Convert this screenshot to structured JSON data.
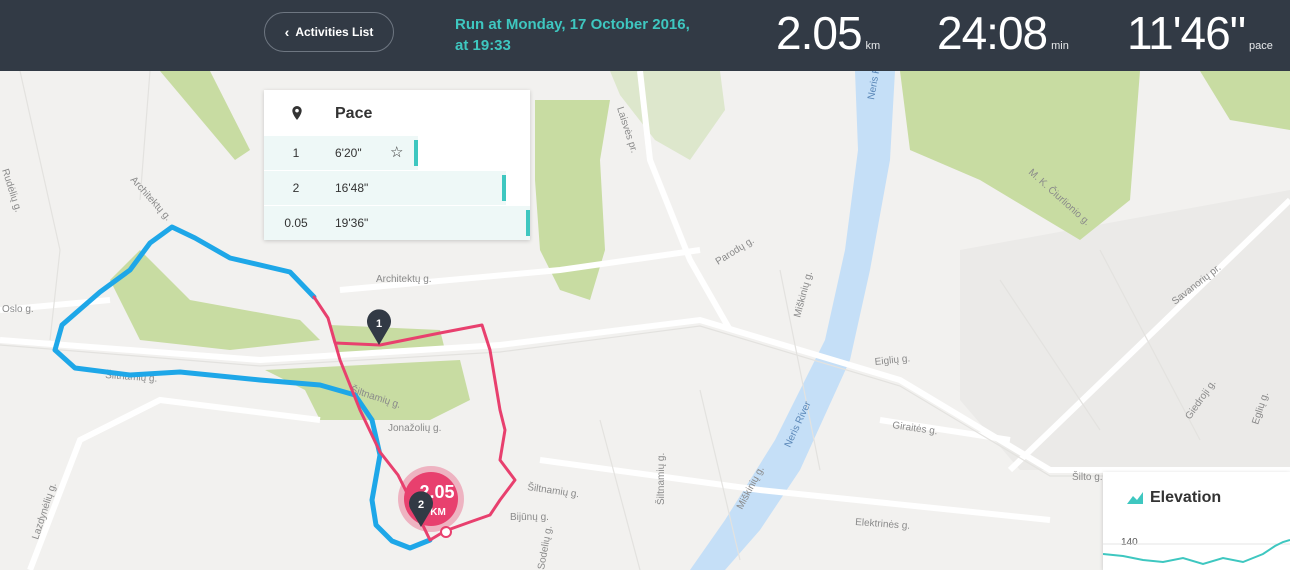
{
  "header": {
    "back_label": "Activities List",
    "title_line1": "Run at Monday, 17 October 2016,",
    "title_line2": "at 19:33",
    "distance": {
      "value": "2.05",
      "unit": "km"
    },
    "duration": {
      "value": "24:08",
      "unit": "min"
    },
    "pace": {
      "value": "11'46\"",
      "unit": "pace"
    }
  },
  "pace_panel": {
    "title": "Pace",
    "rows": [
      {
        "km": "1",
        "pace": "6'20\"",
        "fraction": 0.58,
        "best": true
      },
      {
        "km": "2",
        "pace": "16'48\"",
        "fraction": 0.91,
        "best": false
      },
      {
        "km": "0.05",
        "pace": "19'36\"",
        "fraction": 1.0,
        "best": false
      }
    ]
  },
  "elevation_panel": {
    "title": "Elevation",
    "tick": "140"
  },
  "map": {
    "finish_badge": {
      "line1": "2.05",
      "line2": "KM"
    },
    "km_markers": [
      "1",
      "2"
    ],
    "street_labels": {
      "architektu_g": "Architektų g.",
      "architektu_g2": "Architektų g.",
      "oslo_g": "Oslo g.",
      "siltnamiu_g": "Šiltnamių g.",
      "siltnamiu_g2": "Šiltnamių g.",
      "siltnamiu_g3": "Šiltnamių g.",
      "siltnamiu_g4": "Šiltnamių g.",
      "jonazoliu_g": "Jonažolių g.",
      "lazdyneliu_g": "Lazdynėlių g.",
      "laisves_pr": "Laisvės pr.",
      "neris_river": "Neris River",
      "neris_river2": "Neris River",
      "paroduu_g": "Parodų g.",
      "miskiniu_g": "Miškinių g.",
      "miskiniu_g2": "Miškinių g.",
      "eiguliu_g": "Eiglių g.",
      "giraites_g": "Giraitės g.",
      "elektrines_g": "Elektrinės g.",
      "ciurlionio_g": "M. K. Čiurlionio g.",
      "savanoriu_pr": "Savanorių pr.",
      "siltnamiu_g5": "Šiltnamių g.",
      "gedvoji": "Giedroji g.",
      "egliu": "Eglių g.",
      "bijunu_g": "Bijūnų g.",
      "sodeliu_g": "Sodelių g.",
      "siltu_g": "Šilto g.",
      "rudeliu_g": "Rudėlių g."
    }
  },
  "colors": {
    "topbar": "#323a45",
    "accent": "#3ec7c0",
    "route_km1": "#1ea7e8",
    "route_km2": "#e8406e",
    "park": "#c8dca2",
    "river": "#c5dff7"
  }
}
